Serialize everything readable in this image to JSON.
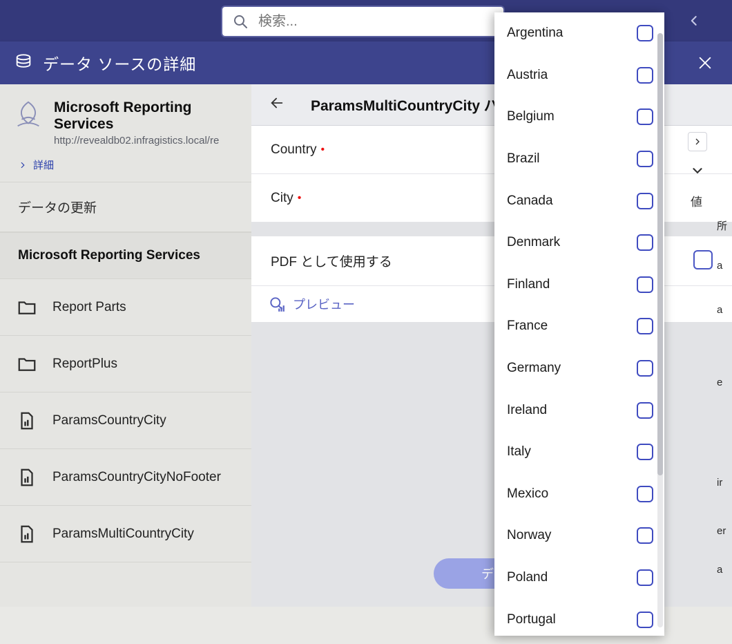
{
  "search": {
    "placeholder": "検索..."
  },
  "modal": {
    "title": "データ ソースの詳細"
  },
  "source": {
    "name": "Microsoft Reporting Services",
    "url": "http://revealdb02.infragistics.local/re",
    "details_label": "詳細",
    "refresh_label": "データの更新",
    "provider_label": "Microsoft Reporting Services"
  },
  "items": [
    {
      "label": "Report Parts",
      "kind": "folder"
    },
    {
      "label": "ReportPlus",
      "kind": "folder"
    },
    {
      "label": "ParamsCountryCity",
      "kind": "report"
    },
    {
      "label": "ParamsCountryCityNoFooter",
      "kind": "report"
    },
    {
      "label": "ParamsMultiCountryCity",
      "kind": "report"
    }
  ],
  "params_panel": {
    "title": "ParamsMultiCountryCity パラ",
    "country_label": "Country",
    "city_label": "City",
    "pdf_label": "PDF として使用する",
    "preview_label": "プレビュー",
    "load_button": "データを"
  },
  "right": {
    "value_label": "値"
  },
  "right_text_bits": [
    "所",
    "a",
    "a",
    "e",
    "ir",
    "er",
    "a"
  ],
  "countries": [
    "Argentina",
    "Austria",
    "Belgium",
    "Brazil",
    "Canada",
    "Denmark",
    "Finland",
    "France",
    "Germany",
    "Ireland",
    "Italy",
    "Mexico",
    "Norway",
    "Poland",
    "Portugal"
  ]
}
